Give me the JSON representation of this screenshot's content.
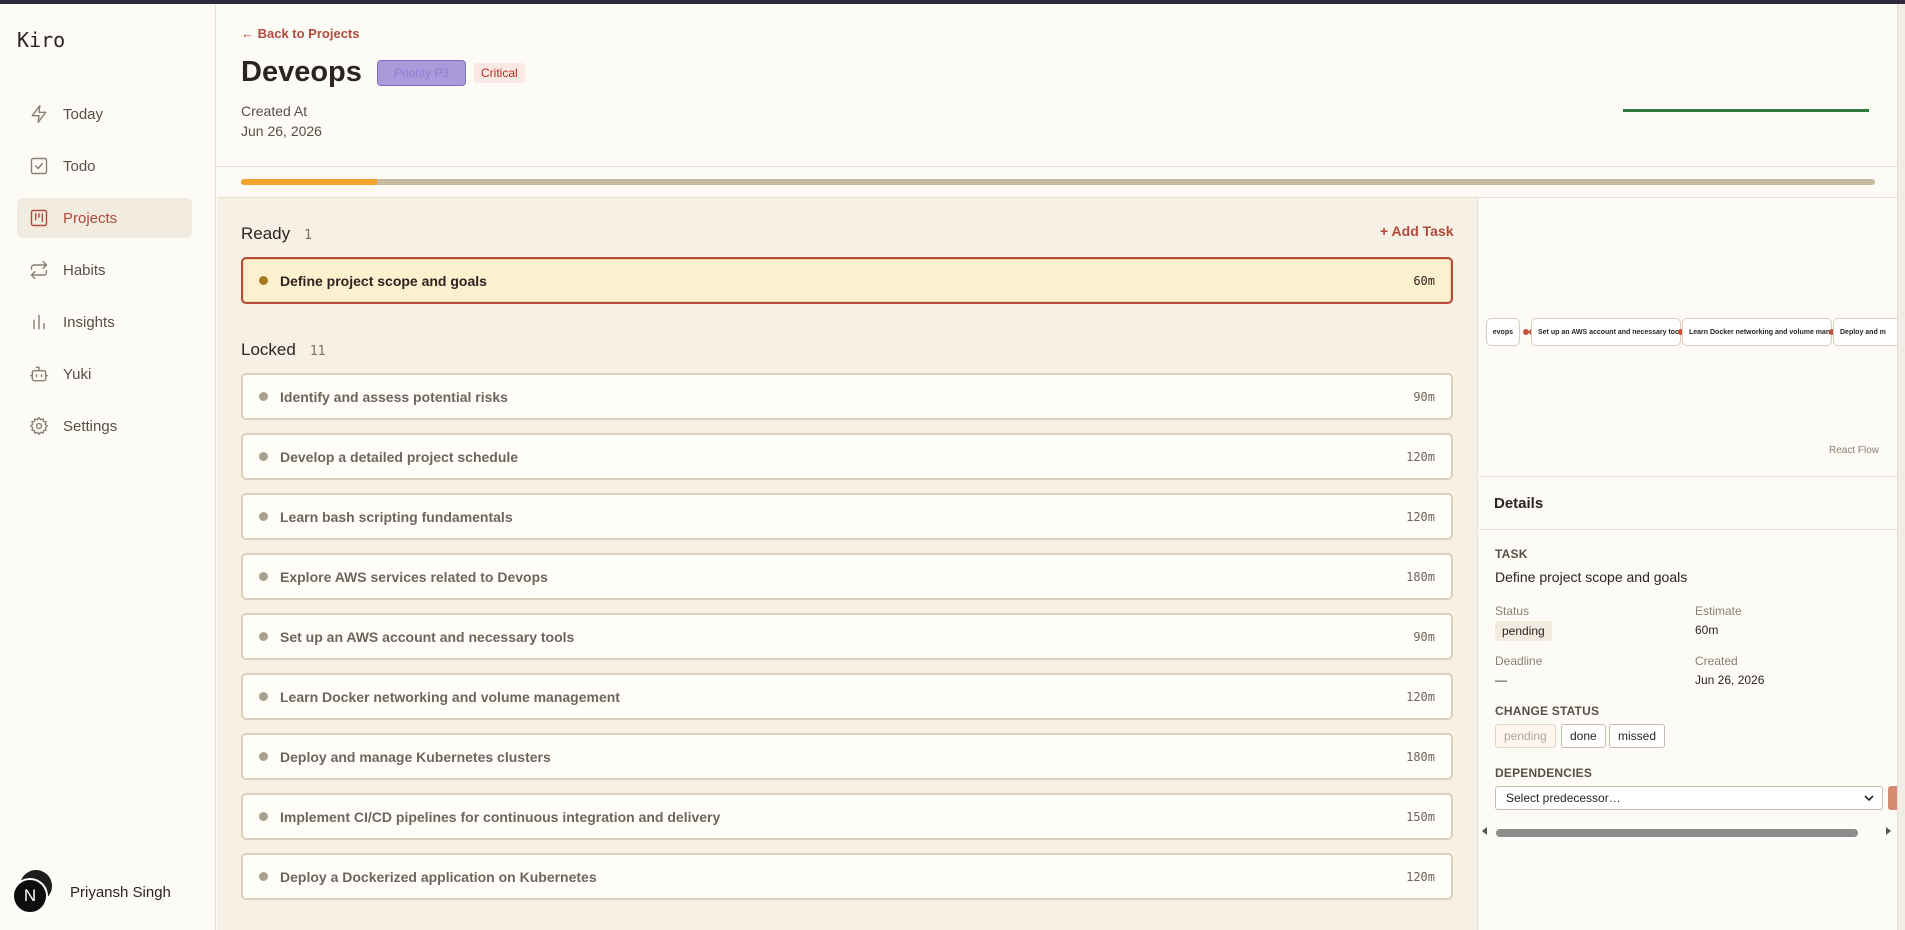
{
  "app": {
    "name": "Kiro"
  },
  "sidebar": {
    "items": [
      {
        "label": "Today",
        "icon": "bolt-icon"
      },
      {
        "label": "Todo",
        "icon": "checkbox-icon"
      },
      {
        "label": "Projects",
        "icon": "projects-icon",
        "active": true
      },
      {
        "label": "Habits",
        "icon": "repeat-icon"
      },
      {
        "label": "Insights",
        "icon": "bar-chart-icon"
      },
      {
        "label": "Yuki",
        "icon": "bot-icon"
      },
      {
        "label": "Settings",
        "icon": "gear-icon"
      }
    ],
    "user": {
      "name": "Priyansh Singh",
      "avatar_initial": "N"
    }
  },
  "header": {
    "back_label": "← Back to Projects",
    "title": "Deveops",
    "priority_badge": "Priority P3",
    "severity_badge": "Critical",
    "created_label": "Created At",
    "created_value": "Jun 26, 2026",
    "progress_fraction": 0.083
  },
  "board": {
    "add_task_label": "+ Add Task",
    "ready": {
      "title": "Ready",
      "count": "1",
      "tasks": [
        {
          "name": "Define project scope and goals",
          "minutes": "60m"
        }
      ]
    },
    "locked": {
      "title": "Locked",
      "count": "11",
      "tasks": [
        {
          "name": "Identify and assess potential risks",
          "minutes": "90m"
        },
        {
          "name": "Develop a detailed project schedule",
          "minutes": "120m"
        },
        {
          "name": "Learn bash scripting fundamentals",
          "minutes": "120m"
        },
        {
          "name": "Explore AWS services related to Devops",
          "minutes": "180m"
        },
        {
          "name": "Set up an AWS account and necessary tools",
          "minutes": "90m"
        },
        {
          "name": "Learn Docker networking and volume management",
          "minutes": "120m"
        },
        {
          "name": "Deploy and manage Kubernetes clusters",
          "minutes": "180m"
        },
        {
          "name": "Implement CI/CD pipelines for continuous integration and delivery",
          "minutes": "150m"
        },
        {
          "name": "Deploy a Dockerized application on Kubernetes",
          "minutes": "120m"
        }
      ]
    }
  },
  "flow": {
    "nodes": [
      "evops",
      "Set up an AWS account and necessary tools",
      "Learn Docker networking and volume manag",
      "Deploy and m"
    ],
    "watermark": "React Flow"
  },
  "details": {
    "title": "Details",
    "task_label": "TASK",
    "task_name": "Define project scope and goals",
    "status_label": "Status",
    "status_value": "pending",
    "estimate_label": "Estimate",
    "estimate_value": "60m",
    "deadline_label": "Deadline",
    "deadline_value": "—",
    "created_label": "Created",
    "created_value": "Jun 26, 2026",
    "change_status_label": "CHANGE STATUS",
    "status_buttons": [
      "pending",
      "done",
      "missed"
    ],
    "dependencies_label": "DEPENDENCIES",
    "select_placeholder": "Select predecessor…"
  },
  "colors": {
    "accent": "#b24a3b",
    "progress": "#f2a52a",
    "priority": "#a99ad9",
    "critical": "#b52a20"
  }
}
